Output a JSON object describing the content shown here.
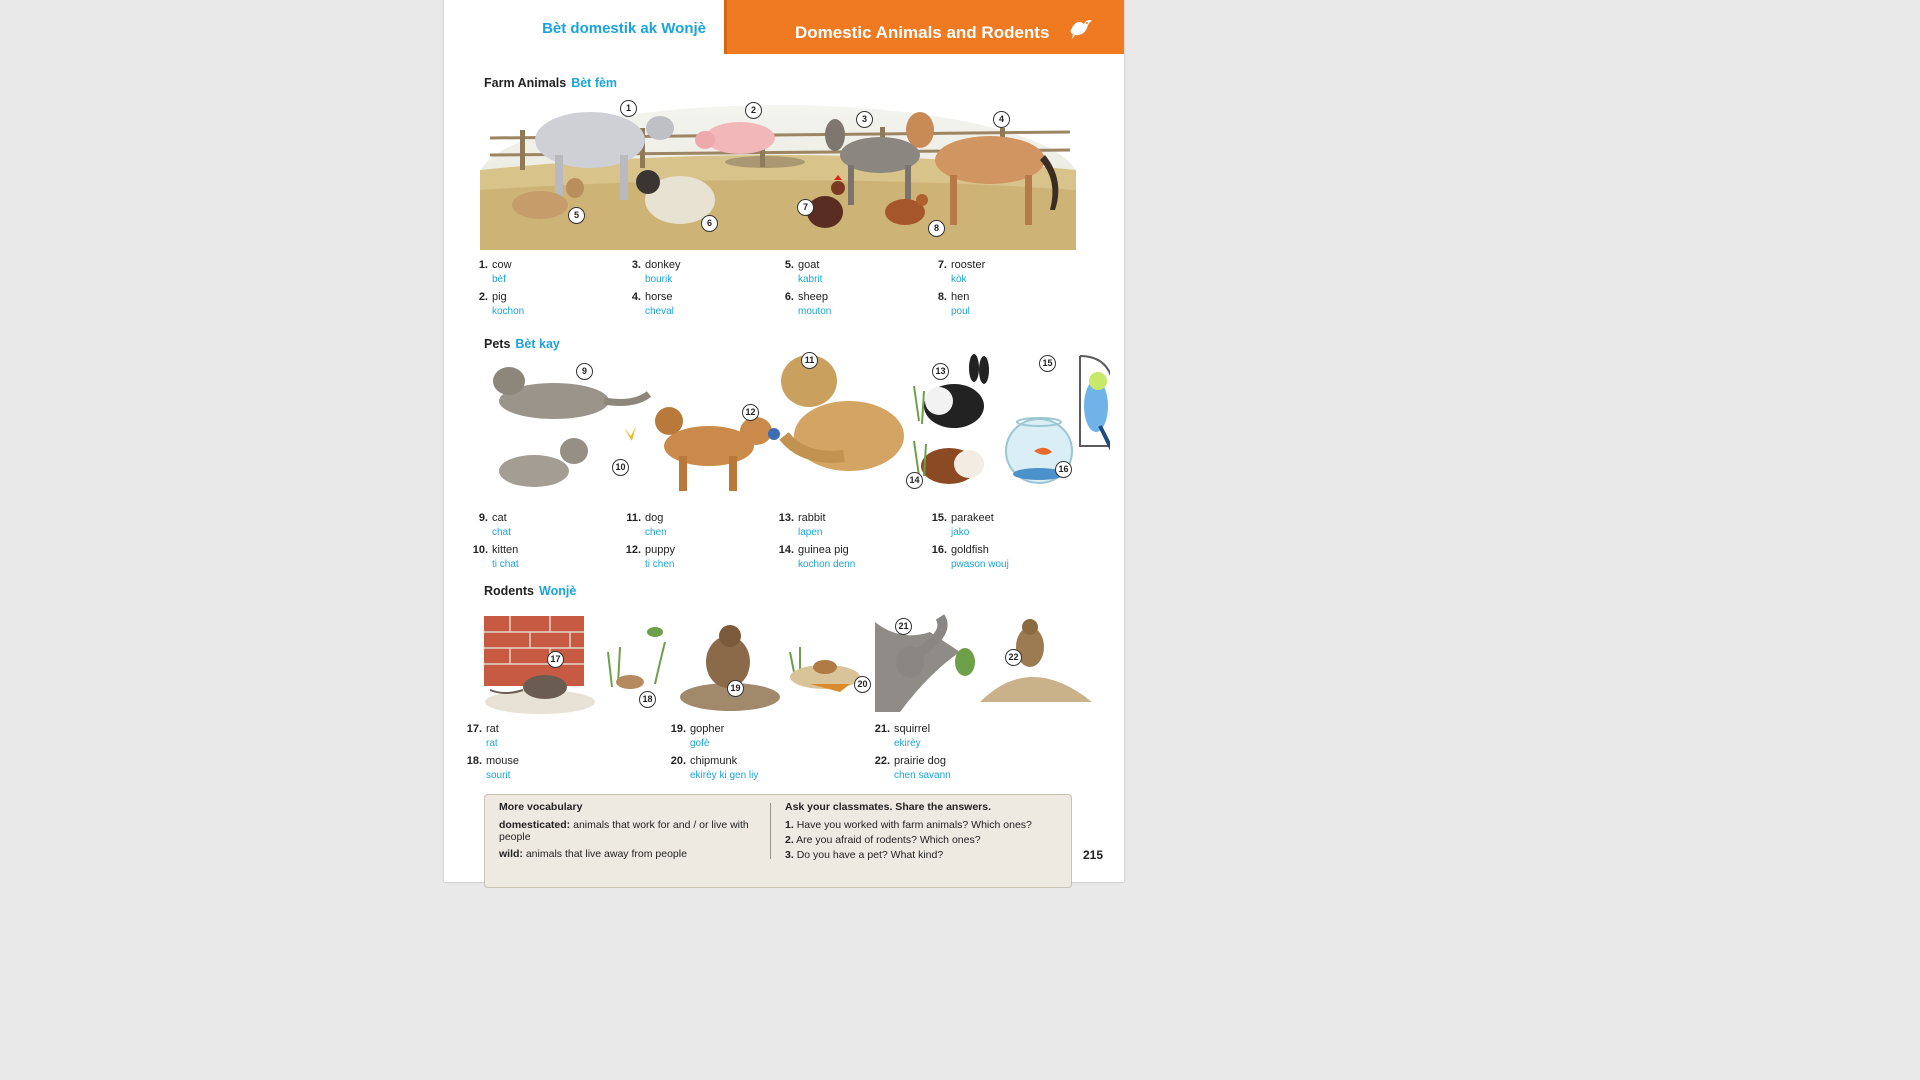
{
  "header": {
    "left_title": "Bèt domestik ak Wonjè",
    "right_title": "Domestic Animals and Rodents",
    "icon": "bird-icon"
  },
  "sections": {
    "farm": {
      "title": "Farm Animals",
      "title_ht": "Bèt fèm"
    },
    "pets": {
      "title": "Pets",
      "title_ht": "Bèt kay"
    },
    "rodents": {
      "title": "Rodents",
      "title_ht": "Wonjè"
    }
  },
  "farm_items": [
    {
      "num": "1.",
      "en": "cow",
      "ht": "bèf"
    },
    {
      "num": "2.",
      "en": "pig",
      "ht": "kochon"
    },
    {
      "num": "3.",
      "en": "donkey",
      "ht": "bourik"
    },
    {
      "num": "4.",
      "en": "horse",
      "ht": "cheval"
    },
    {
      "num": "5.",
      "en": "goat",
      "ht": "kabrit"
    },
    {
      "num": "6.",
      "en": "sheep",
      "ht": "mouton"
    },
    {
      "num": "7.",
      "en": "rooster",
      "ht": "kòk"
    },
    {
      "num": "8.",
      "en": "hen",
      "ht": "poul"
    }
  ],
  "pet_items": [
    {
      "num": "9.",
      "en": "cat",
      "ht": "chat"
    },
    {
      "num": "10.",
      "en": "kitten",
      "ht": "ti chat"
    },
    {
      "num": "11.",
      "en": "dog",
      "ht": "chen"
    },
    {
      "num": "12.",
      "en": "puppy",
      "ht": "ti chen"
    },
    {
      "num": "13.",
      "en": "rabbit",
      "ht": "lapen"
    },
    {
      "num": "14.",
      "en": "guinea pig",
      "ht": "kochon denn"
    },
    {
      "num": "15.",
      "en": "parakeet",
      "ht": "jako"
    },
    {
      "num": "16.",
      "en": "goldfish",
      "ht": "pwason wouj"
    }
  ],
  "rodent_items": [
    {
      "num": "17.",
      "en": "rat",
      "ht": "rat"
    },
    {
      "num": "18.",
      "en": "mouse",
      "ht": "sourit"
    },
    {
      "num": "19.",
      "en": "gopher",
      "ht": "gofè"
    },
    {
      "num": "20.",
      "en": "chipmunk",
      "ht": "ekirèy ki gen liy"
    },
    {
      "num": "21.",
      "en": "squirrel",
      "ht": "ekirèy"
    },
    {
      "num": "22.",
      "en": "prairie dog",
      "ht": "chen savann"
    }
  ],
  "callouts": [
    "1",
    "2",
    "3",
    "4",
    "5",
    "6",
    "7",
    "8",
    "9",
    "10",
    "11",
    "12",
    "13",
    "14",
    "15",
    "16",
    "17",
    "18",
    "19",
    "20",
    "21",
    "22"
  ],
  "more_vocab": {
    "title": "More vocabulary",
    "term1": "domesticated:",
    "def1": "animals that work for and / or live with people",
    "term2": "wild:",
    "def2": "animals that live away from people"
  },
  "ask": {
    "title": "Ask your classmates. Share the answers.",
    "questions": [
      {
        "num": "1.",
        "text": "Have you worked with farm animals? Which ones?"
      },
      {
        "num": "2.",
        "text": "Are you afraid of rodents? Which ones?"
      },
      {
        "num": "3.",
        "text": "Do you have a pet? What kind?"
      }
    ]
  },
  "page_number": "215",
  "colors": {
    "accent": "#ef7a22",
    "translation": "#1aa4db"
  }
}
